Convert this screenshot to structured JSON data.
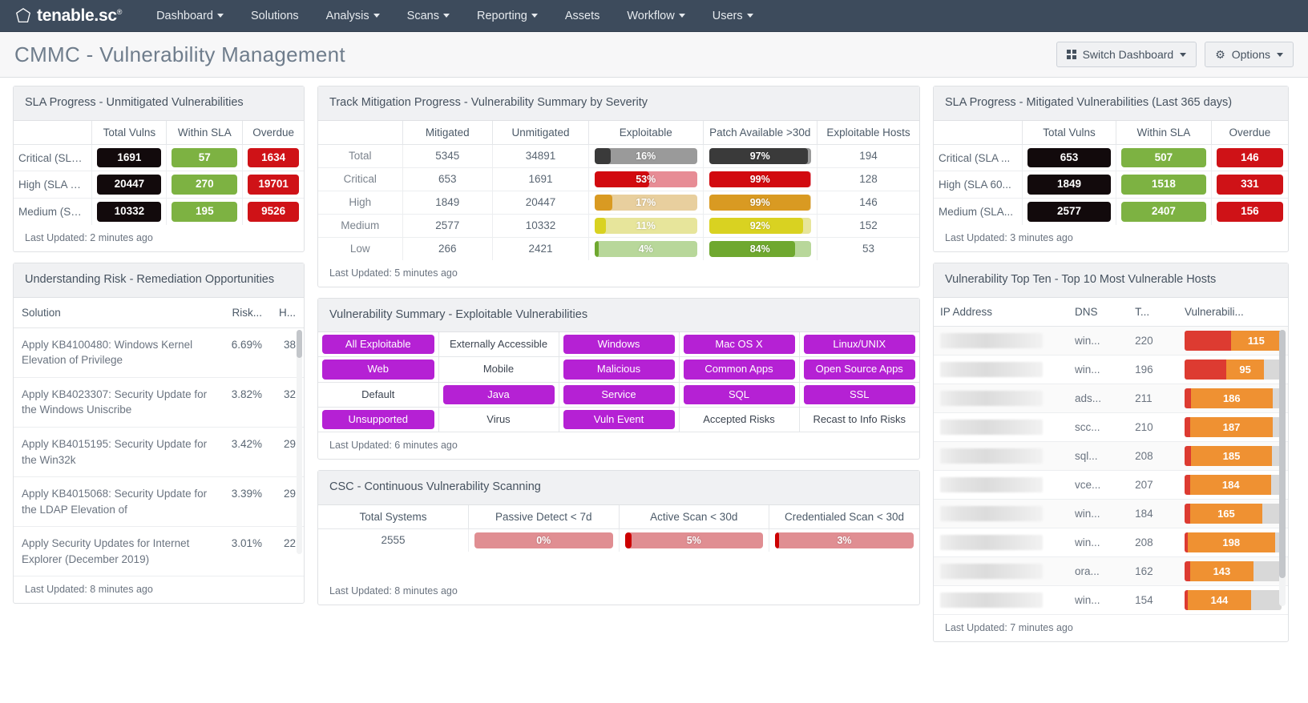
{
  "nav": {
    "brand": "tenable.sc",
    "brand_tm": "®",
    "items": [
      {
        "label": "Dashboard",
        "caret": true
      },
      {
        "label": "Solutions",
        "caret": false
      },
      {
        "label": "Analysis",
        "caret": true
      },
      {
        "label": "Scans",
        "caret": true
      },
      {
        "label": "Reporting",
        "caret": true
      },
      {
        "label": "Assets",
        "caret": false
      },
      {
        "label": "Workflow",
        "caret": true
      },
      {
        "label": "Users",
        "caret": true
      }
    ]
  },
  "header": {
    "title": "CMMC - Vulnerability Management",
    "switch_dashboard": "Switch Dashboard",
    "options": "Options"
  },
  "sla_unmitigated": {
    "title": "SLA Progress - Unmitigated Vulnerabilities",
    "columns": [
      "",
      "Total Vulns",
      "Within SLA",
      "Overdue"
    ],
    "rows": [
      {
        "label": "Critical (SLA ...",
        "total": "1691",
        "within": "57",
        "overdue": "1634"
      },
      {
        "label": "High (SLA 60...",
        "total": "20447",
        "within": "270",
        "overdue": "19701"
      },
      {
        "label": "Medium (SLA...",
        "total": "10332",
        "within": "195",
        "overdue": "9526"
      }
    ],
    "updated": "Last Updated: 2 minutes ago"
  },
  "remediation": {
    "title": "Understanding Risk - Remediation Opportunities",
    "columns": [
      "Solution",
      "Risk...",
      "H..."
    ],
    "rows": [
      {
        "solution": "Apply KB4100480: Windows Kernel Elevation of Privilege",
        "risk": "6.69%",
        "hosts": "38"
      },
      {
        "solution": "Apply KB4023307: Security Update for the Windows Uniscribe",
        "risk": "3.82%",
        "hosts": "32"
      },
      {
        "solution": "Apply KB4015195: Security Update for the Win32k",
        "risk": "3.42%",
        "hosts": "29"
      },
      {
        "solution": "Apply KB4015068: Security Update for the LDAP Elevation of",
        "risk": "3.39%",
        "hosts": "29"
      },
      {
        "solution": "Apply Security Updates for Internet Explorer (December 2019)",
        "risk": "3.01%",
        "hosts": "22"
      }
    ],
    "updated": "Last Updated: 8 minutes ago"
  },
  "mitigation_progress": {
    "title": "Track Mitigation Progress - Vulnerability Summary by Severity",
    "columns": [
      "",
      "Mitigated",
      "Unmitigated",
      "Exploitable",
      "Patch Available >30d",
      "Exploitable Hosts"
    ],
    "rows": [
      {
        "label": "Total",
        "mitigated": "5345",
        "unmitigated": "34891",
        "exploitable_pct": "16%",
        "exploitable_value": 16,
        "patch_pct": "97%",
        "patch_value": 97,
        "hosts": "194",
        "fill": "#3a3a3a",
        "track": "#9a9a9a"
      },
      {
        "label": "Critical",
        "mitigated": "653",
        "unmitigated": "1691",
        "exploitable_pct": "53%",
        "exploitable_value": 53,
        "patch_pct": "99%",
        "patch_value": 99,
        "hosts": "128",
        "fill": "#d20a0f",
        "track": "#e78c95"
      },
      {
        "label": "High",
        "mitigated": "1849",
        "unmitigated": "20447",
        "exploitable_pct": "17%",
        "exploitable_value": 17,
        "patch_pct": "99%",
        "patch_value": 99,
        "hosts": "146",
        "fill": "#d99a22",
        "track": "#e8cf9e"
      },
      {
        "label": "Medium",
        "mitigated": "2577",
        "unmitigated": "10332",
        "exploitable_pct": "11%",
        "exploitable_value": 11,
        "patch_pct": "92%",
        "patch_value": 92,
        "hosts": "152",
        "fill": "#d9d221",
        "track": "#e7e59b"
      },
      {
        "label": "Low",
        "mitigated": "266",
        "unmitigated": "2421",
        "exploitable_pct": "4%",
        "exploitable_value": 4,
        "patch_pct": "84%",
        "patch_value": 84,
        "hosts": "53",
        "fill": "#6fa82f",
        "track": "#b8d79a"
      }
    ],
    "updated": "Last Updated: 5 minutes ago"
  },
  "exploitable_summary": {
    "title": "Vulnerability Summary - Exploitable Vulnerabilities",
    "cells": [
      [
        {
          "label": "All Exploitable",
          "on": true
        },
        {
          "label": "Externally Accessible",
          "on": false
        },
        {
          "label": "Windows",
          "on": true
        },
        {
          "label": "Mac OS X",
          "on": true
        },
        {
          "label": "Linux/UNIX",
          "on": true
        }
      ],
      [
        {
          "label": "Web",
          "on": true
        },
        {
          "label": "Mobile",
          "on": false
        },
        {
          "label": "Malicious",
          "on": true
        },
        {
          "label": "Common Apps",
          "on": true
        },
        {
          "label": "Open Source Apps",
          "on": true
        }
      ],
      [
        {
          "label": "Default",
          "on": false
        },
        {
          "label": "Java",
          "on": true
        },
        {
          "label": "Service",
          "on": true
        },
        {
          "label": "SQL",
          "on": true
        },
        {
          "label": "SSL",
          "on": true
        }
      ],
      [
        {
          "label": "Unsupported",
          "on": true
        },
        {
          "label": "Virus",
          "on": false
        },
        {
          "label": "Vuln Event",
          "on": true
        },
        {
          "label": "Accepted Risks",
          "on": false
        },
        {
          "label": "Recast to Info Risks",
          "on": false
        }
      ]
    ],
    "updated": "Last Updated: 6 minutes ago"
  },
  "csc": {
    "title": "CSC - Continuous Vulnerability Scanning",
    "columns": [
      "Total Systems",
      "Passive Detect < 7d",
      "Active Scan < 30d",
      "Credentialed Scan < 30d"
    ],
    "total_systems": "2555",
    "bars": [
      {
        "pct": "0%",
        "value": 0,
        "fill": "#cc0000",
        "track": "#e08e92"
      },
      {
        "pct": "5%",
        "value": 5,
        "fill": "#cc0000",
        "track": "#e08e92"
      },
      {
        "pct": "3%",
        "value": 3,
        "fill": "#cc0000",
        "track": "#e08e92"
      }
    ],
    "updated": "Last Updated: 8 minutes ago"
  },
  "sla_mitigated": {
    "title": "SLA Progress - Mitigated Vulnerabilities (Last 365 days)",
    "columns": [
      "",
      "Total Vulns",
      "Within SLA",
      "Overdue"
    ],
    "rows": [
      {
        "label": "Critical (SLA ...",
        "total": "653",
        "within": "507",
        "overdue": "146"
      },
      {
        "label": "High (SLA 60...",
        "total": "1849",
        "within": "1518",
        "overdue": "331"
      },
      {
        "label": "Medium (SLA...",
        "total": "2577",
        "within": "2407",
        "overdue": "156"
      }
    ],
    "updated": "Last Updated: 3 minutes ago"
  },
  "top_ten": {
    "title": "Vulnerability Top Ten - Top 10 Most Vulnerable Hosts",
    "columns": [
      "IP Address",
      "DNS",
      "T...",
      "Vulnerabili..."
    ],
    "rows": [
      {
        "ip": "",
        "dns": "win...",
        "total": "220",
        "crit": 105,
        "high": 115,
        "high_label": "115"
      },
      {
        "ip": "",
        "dns": "win...",
        "total": "196",
        "crit": 95,
        "high": 85,
        "high_label": "95"
      },
      {
        "ip": "",
        "dns": "ads...",
        "total": "211",
        "crit": 14,
        "high": 186,
        "high_label": "186"
      },
      {
        "ip": "",
        "dns": "scc...",
        "total": "210",
        "crit": 13,
        "high": 187,
        "high_label": "187"
      },
      {
        "ip": "",
        "dns": "sql...",
        "total": "208",
        "crit": 14,
        "high": 185,
        "high_label": "185"
      },
      {
        "ip": "",
        "dns": "vce...",
        "total": "207",
        "crit": 13,
        "high": 184,
        "high_label": "184"
      },
      {
        "ip": "",
        "dns": "win...",
        "total": "184",
        "crit": 12,
        "high": 165,
        "high_label": "165"
      },
      {
        "ip": "",
        "dns": "win...",
        "total": "208",
        "crit": 7,
        "high": 198,
        "high_label": "198"
      },
      {
        "ip": "",
        "dns": "ora...",
        "total": "162",
        "crit": 13,
        "high": 143,
        "high_label": "143"
      },
      {
        "ip": "",
        "dns": "win...",
        "total": "154",
        "crit": 7,
        "high": 144,
        "high_label": "144"
      }
    ],
    "updated": "Last Updated: 7 minutes ago"
  },
  "colors": {
    "nav_bg": "#3d4b5c",
    "accent_purple": "#b521d4",
    "critical_red": "#cf1217",
    "sla_green": "#7db242",
    "high_orange": "#ef9132",
    "crit_bar_red": "#dd3b31"
  }
}
